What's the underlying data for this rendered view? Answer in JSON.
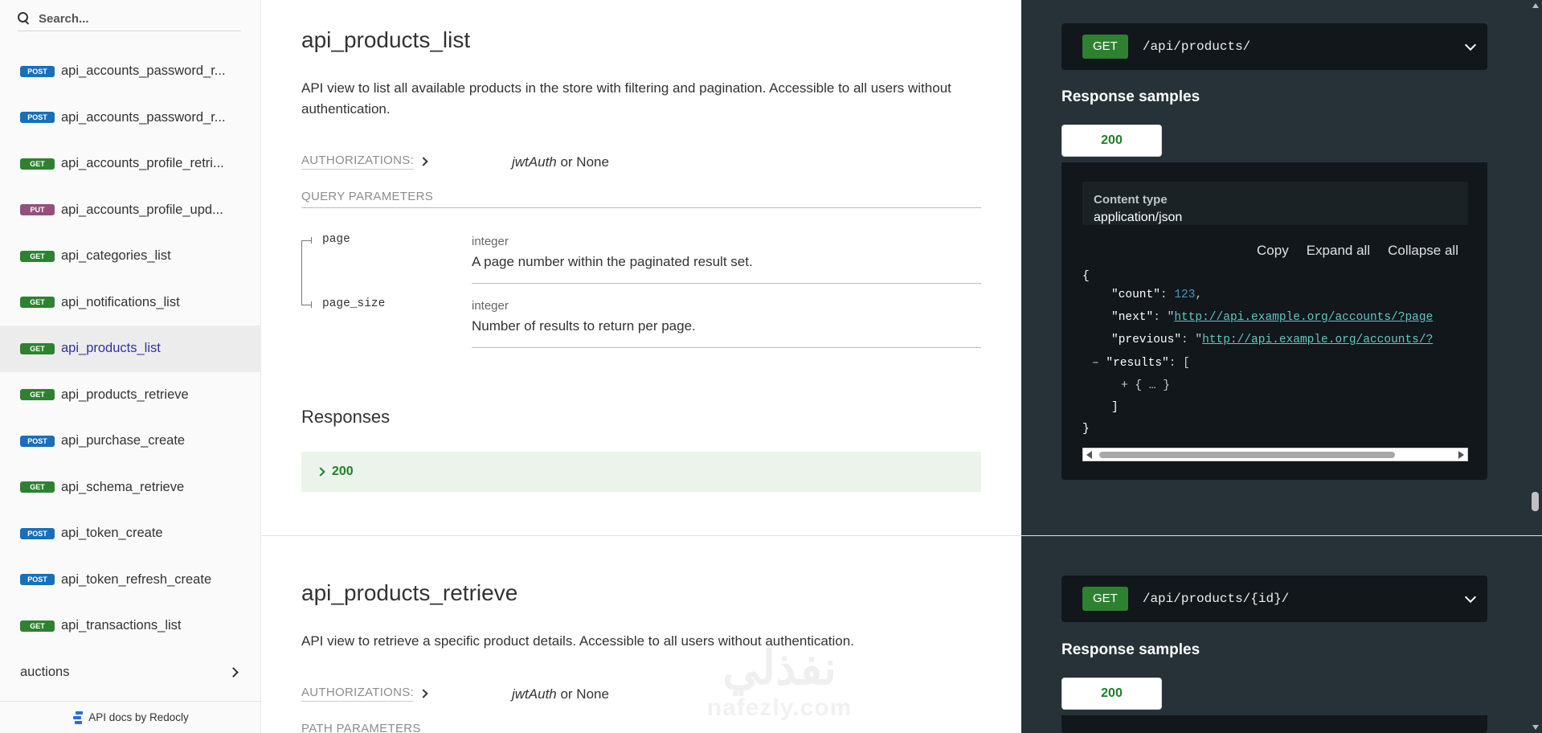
{
  "search": {
    "placeholder": "Search..."
  },
  "sidebar": {
    "items": [
      {
        "method": "POST",
        "label": "api_accounts_password_r..."
      },
      {
        "method": "POST",
        "label": "api_accounts_password_r..."
      },
      {
        "method": "GET",
        "label": "api_accounts_profile_retri..."
      },
      {
        "method": "PUT",
        "label": "api_accounts_profile_upd..."
      },
      {
        "method": "GET",
        "label": "api_categories_list"
      },
      {
        "method": "GET",
        "label": "api_notifications_list"
      },
      {
        "method": "GET",
        "label": "api_products_list"
      },
      {
        "method": "GET",
        "label": "api_products_retrieve"
      },
      {
        "method": "POST",
        "label": "api_purchase_create"
      },
      {
        "method": "GET",
        "label": "api_schema_retrieve"
      },
      {
        "method": "POST",
        "label": "api_token_create"
      },
      {
        "method": "POST",
        "label": "api_token_refresh_create"
      },
      {
        "method": "GET",
        "label": "api_transactions_list"
      }
    ],
    "group": "auctions",
    "footer": "API docs by Redocly"
  },
  "op1": {
    "title": "api_products_list",
    "description": "API view to list all available products in the store with filtering and pagination. Accessible to all users without authentication.",
    "auth_label": "AUTHORIZATIONS:",
    "auth_scheme": "jwtAuth",
    "auth_rest": " or None",
    "query_label": "QUERY PARAMETERS",
    "params": [
      {
        "name": "page",
        "type": "integer",
        "desc": "A page number within the paginated result set."
      },
      {
        "name": "page_size",
        "type": "integer",
        "desc": "Number of results to return per page."
      }
    ],
    "responses_title": "Responses",
    "response_code": "200"
  },
  "op2": {
    "title": "api_products_retrieve",
    "description": "API view to retrieve a specific product details. Accessible to all users without authentication.",
    "auth_label": "AUTHORIZATIONS:",
    "auth_scheme": "jwtAuth",
    "auth_rest": " or None",
    "path_label": "PATH PARAMETERS"
  },
  "right1": {
    "method": "GET",
    "path": "/api/products/",
    "samples_title": "Response samples",
    "tab": "200",
    "content_type_label": "Content type",
    "content_type": "application/json",
    "actions": [
      "Copy",
      "Expand all",
      "Collapse all"
    ],
    "code": {
      "open": "{",
      "count_key": "\"count\"",
      "count_val": "123",
      "next_key": "\"next\"",
      "next_val": "http://api.example.org/accounts/?page",
      "prev_key": "\"previous\"",
      "prev_val": "http://api.example.org/accounts/?",
      "results_key": "\"results\"",
      "collapsed": "{ … }",
      "close_bracket": "]",
      "close": "}"
    }
  },
  "right2": {
    "method": "GET",
    "path": "/api/products/{id}/",
    "samples_title": "Response samples",
    "tab": "200"
  },
  "watermark": {
    "arabic": "نفذلي",
    "latin": "nafezly.com"
  },
  "colors": {
    "post": "#186fbb",
    "get": "#2f8132",
    "put": "#95507c",
    "right_panel": "#263238"
  }
}
